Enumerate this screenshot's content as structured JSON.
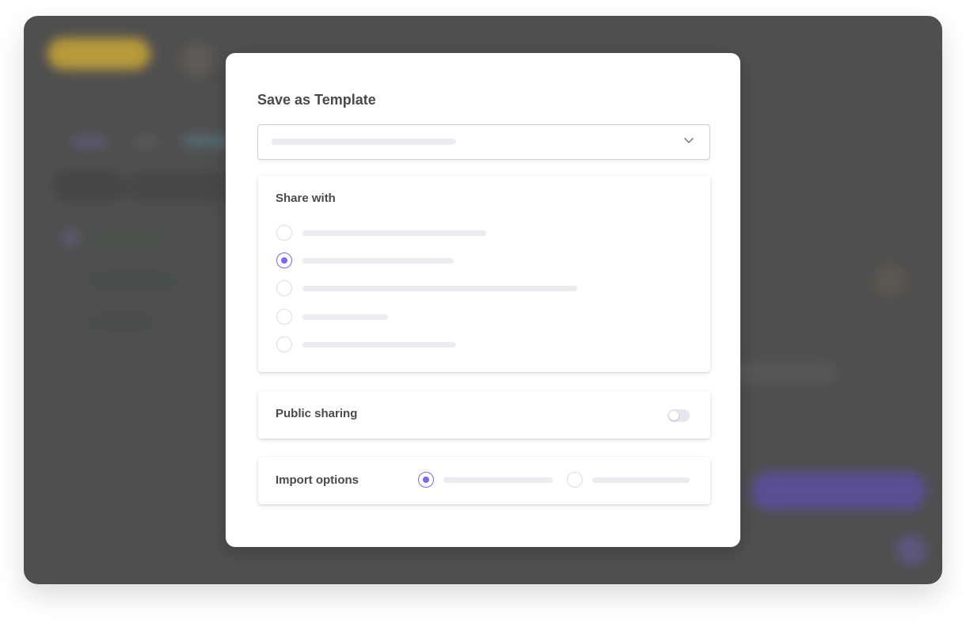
{
  "modal": {
    "title": "Save as Template",
    "template_select": {
      "selected_value": "",
      "icon": "chevron-down-icon"
    },
    "share_with": {
      "title": "Share with",
      "selected_index": 1,
      "options": [
        "",
        "",
        "",
        "",
        ""
      ]
    },
    "public_sharing": {
      "label": "Public sharing",
      "enabled": false
    },
    "import_options": {
      "label": "Import options",
      "selected_index": 0,
      "options": [
        "",
        ""
      ]
    }
  },
  "colors": {
    "accent": "#7b68ee",
    "overlay": "#4f4f4f",
    "placeholder": "#ebebf0",
    "text": "#4a4a4a"
  }
}
